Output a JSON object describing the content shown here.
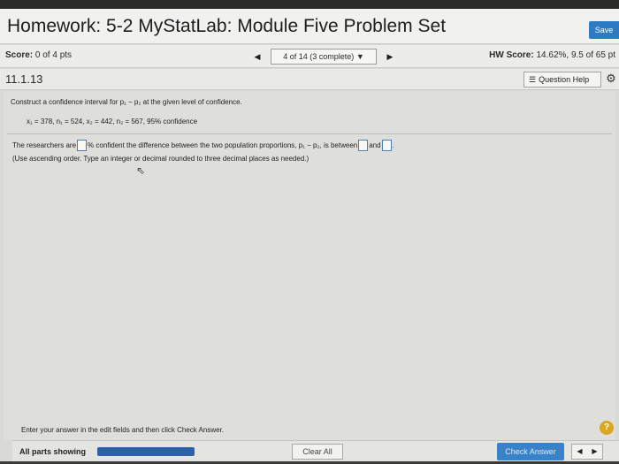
{
  "header": {
    "title": "Homework: 5-2 MyStatLab: Module Five Problem Set",
    "save_label": "Save"
  },
  "score_bar": {
    "score_label": "Score:",
    "score_value": "0 of 4 pts",
    "question_position": "4 of 14 (3 complete)",
    "hw_score_label": "HW Score:",
    "hw_score_value": "14.62%, 9.5 of 65 pt"
  },
  "question_bar": {
    "question_number": "11.1.13",
    "help_label": "Question Help"
  },
  "problem": {
    "prompt": "Construct a confidence interval for p₁ − p₂ at the given level of confidence.",
    "given": "x₁ = 378, n₁ = 524, x₂ = 442, n₂ = 567, 95% confidence",
    "answer_part1": "The researchers are",
    "answer_part2": "% confident the difference between the two population proportions, p₁ − p₂, is between",
    "answer_part3": "and",
    "answer_part4": ".",
    "note": "(Use ascending order. Type an integer or decimal rounded to three decimal places as needed.)"
  },
  "instructions": "Enter your answer in the edit fields and then click Check Answer.",
  "footer": {
    "parts_label": "All parts showing",
    "progress_fraction": 1.0,
    "clear_label": "Clear All",
    "check_label": "Check Answer"
  },
  "icons": {
    "prev": "left-arrow-icon",
    "next": "right-arrow-icon",
    "dropdown": "caret-down-icon",
    "help_list": "list-icon",
    "settings": "gear-icon",
    "help_circle": "question-mark-icon"
  },
  "colors": {
    "accent": "#2e7bc4",
    "progress": "#2e62a8",
    "help_circle": "#d9a820"
  }
}
